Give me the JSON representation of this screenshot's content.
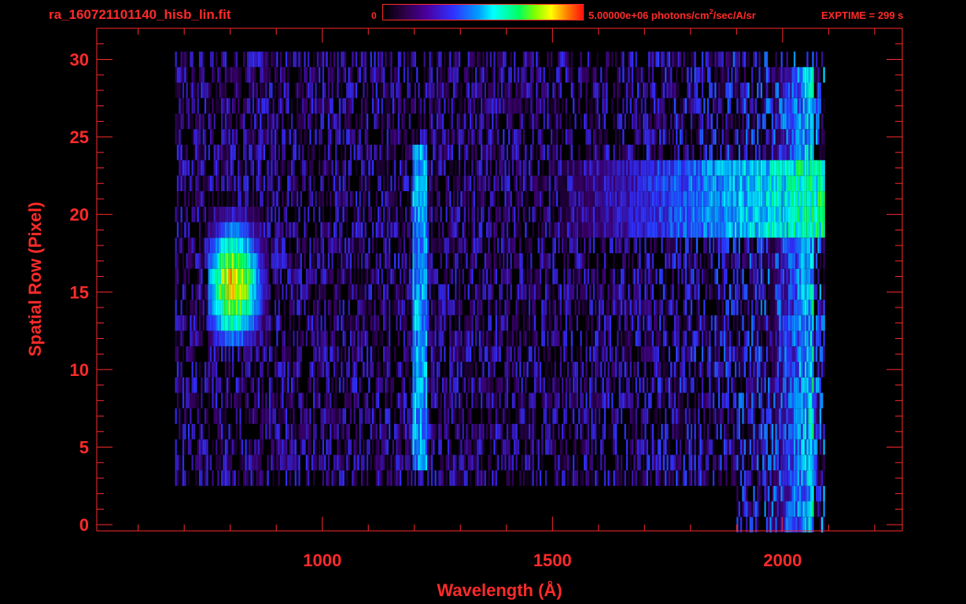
{
  "header": {
    "file_title": "ra_160721101140_hisb_lin.fit",
    "colorbar_min": "0",
    "colorbar_max_base": "5.00000e+06 photons/cm",
    "colorbar_max_sup": "2",
    "colorbar_max_rest": "/sec/A/sr",
    "exptime": "EXPTIME = 299 s"
  },
  "colors": {
    "axis": "#ff2a2a",
    "background": "#000000",
    "colormap": [
      "#000000",
      "#3c0070",
      "#3030ff",
      "#00a0ff",
      "#00ffff",
      "#00ff60",
      "#80ff00",
      "#ffff00",
      "#ff8000",
      "#ff1010"
    ]
  },
  "chart_data": {
    "type": "heatmap",
    "title": "ra_160721101140_hisb_lin.fit",
    "xlabel": "Wavelength (Å)",
    "ylabel": "Spatial Row (Pixel)",
    "xlim": [
      510,
      2260
    ],
    "ylim": [
      -0.4,
      32
    ],
    "x_ticks": [
      {
        "value": 1000,
        "label": "1000"
      },
      {
        "value": 1500,
        "label": "1500"
      },
      {
        "value": 2000,
        "label": "2000"
      }
    ],
    "x_minor_step": 100,
    "y_ticks": [
      {
        "value": 0,
        "label": "0"
      },
      {
        "value": 5,
        "label": "5"
      },
      {
        "value": 10,
        "label": "10"
      },
      {
        "value": 15,
        "label": "15"
      },
      {
        "value": 20,
        "label": "20"
      },
      {
        "value": 25,
        "label": "25"
      },
      {
        "value": 30,
        "label": "30"
      }
    ],
    "y_minor_step": 1,
    "color_scale": {
      "min": 0,
      "max": 5000000,
      "units": "photons/cm^2/sec/A/sr"
    },
    "exptime_s": 299,
    "data_extent": {
      "wavelength": [
        680,
        2090
      ],
      "rows": [
        0,
        30
      ]
    },
    "features": [
      {
        "name": "emission-blob",
        "wavelength": [
          750,
          880
        ],
        "rows": [
          12,
          20
        ],
        "peak_intensity": 0.85
      },
      {
        "name": "band-upper",
        "wavelength": [
          1700,
          2060
        ],
        "rows": [
          19,
          23
        ],
        "peak_intensity": 0.62
      },
      {
        "name": "line-1216",
        "wavelength": [
          1195,
          1225
        ],
        "rows": [
          4,
          24
        ],
        "peak_intensity": 0.45
      },
      {
        "name": "red-edge",
        "wavelength": [
          1960,
          2065
        ],
        "rows": [
          2,
          30
        ],
        "peak_intensity": 0.58
      }
    ]
  }
}
